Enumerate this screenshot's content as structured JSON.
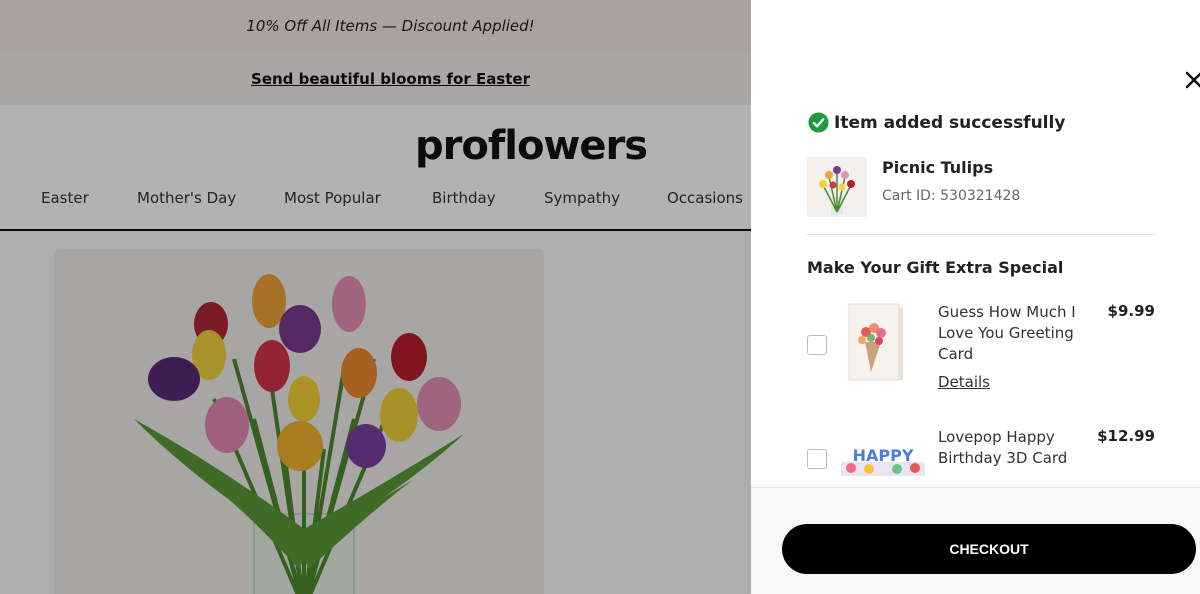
{
  "promo": {
    "text": "10% Off All Items — Discount Applied!"
  },
  "banner": {
    "link_text": "Send beautiful blooms for Easter"
  },
  "header": {
    "logo": "proflowers"
  },
  "nav": {
    "items": [
      {
        "label": "Easter"
      },
      {
        "label": "Mother's Day"
      },
      {
        "label": "Most Popular"
      },
      {
        "label": "Birthday"
      },
      {
        "label": "Sympathy"
      },
      {
        "label": "Occasions"
      }
    ]
  },
  "drawer": {
    "success_text": "Item added successfully",
    "item": {
      "name": "Picnic Tulips",
      "cart_id": "Cart ID: 530321428"
    },
    "section_title": "Make Your Gift Extra Special",
    "addons": [
      {
        "name": "Guess How Much I Love You Greeting Card",
        "price": "$9.99",
        "details_label": "Details"
      },
      {
        "name": "Lovepop Happy Birthday 3D Card",
        "price": "$12.99",
        "thumb_text": "HAPPY"
      }
    ],
    "checkout_label": "CHECKOUT"
  },
  "icons": {
    "close": "close-icon",
    "success": "check-circle-icon"
  },
  "colors": {
    "success_green": "#1e9b3c",
    "checkout_bg": "#000000",
    "promo_bg": "#f5e8e4"
  }
}
